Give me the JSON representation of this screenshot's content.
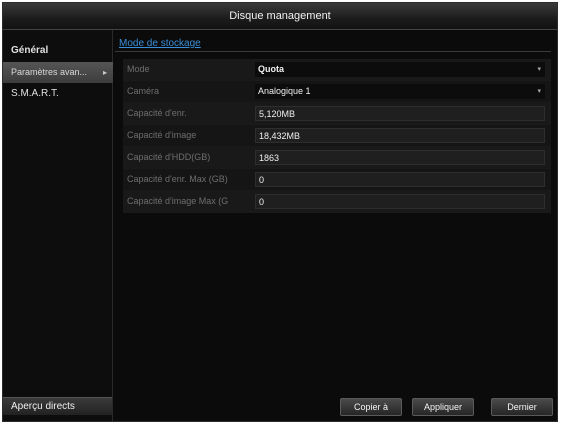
{
  "window": {
    "title": "Disque management"
  },
  "sidebar": {
    "items": [
      {
        "label": "Général"
      },
      {
        "label": "Paramètres avan...",
        "arrow": "▸"
      },
      {
        "label": "S.M.A.R.T."
      }
    ],
    "live_view_label": "Aperçu directs"
  },
  "tab": {
    "label": "Mode de stockage"
  },
  "form": {
    "mode": {
      "label": "Mode",
      "value": "Quota"
    },
    "camera": {
      "label": "Caméra",
      "value": "Analogique 1"
    },
    "record_capacity": {
      "label": "Capacité d'enr.",
      "value": "5,120MB"
    },
    "image_capacity": {
      "label": "Capacité d'image",
      "value": "18,432MB"
    },
    "hdd_capacity": {
      "label": "Capacité d'HDD(GB)",
      "value": "1863"
    },
    "max_record_capacity": {
      "label": "Capacité d'enr. Max (GB)",
      "value": "0"
    },
    "max_image_capacity": {
      "label": "Capacité d'image Max (G",
      "value": "0"
    }
  },
  "buttons": {
    "copy": "Copier à",
    "apply": "Appliquer",
    "back": "Dernier"
  }
}
